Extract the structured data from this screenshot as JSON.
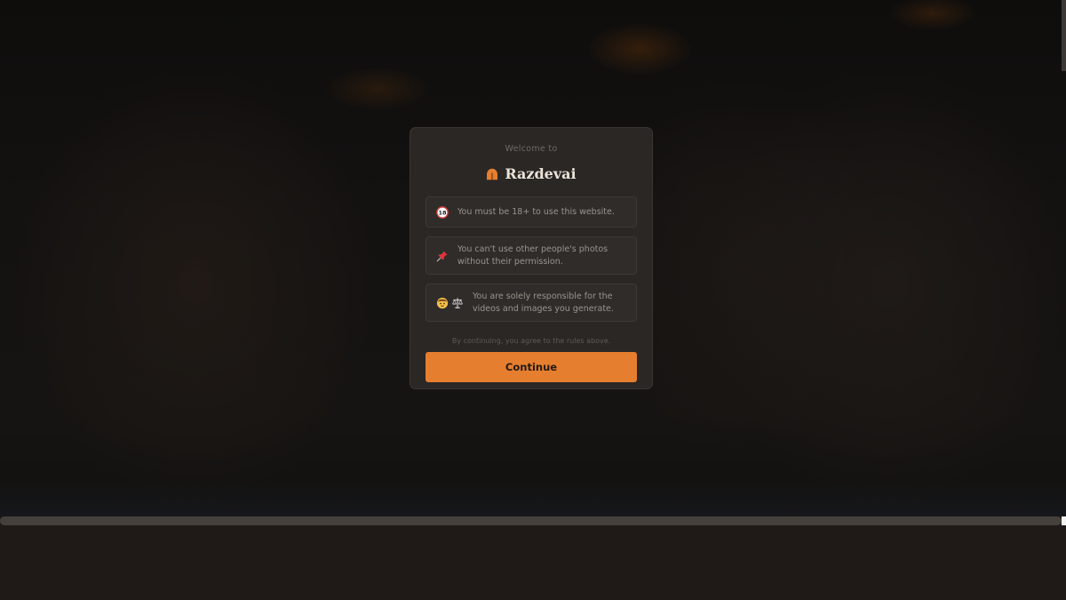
{
  "modal": {
    "welcome_text": "Welcome to",
    "brand_name": "Razdevai",
    "rules": [
      {
        "icons": [
          "18-plus-icon"
        ],
        "text": "You must be 18+ to use this website."
      },
      {
        "icons": [
          "pin-icon"
        ],
        "text": "You can't use other people's photos without their permission."
      },
      {
        "icons": [
          "person-icon",
          "scales-icon"
        ],
        "text": "You are solely responsible for the videos and images you generate."
      }
    ],
    "agree_text": "By continuing, you agree to the rules above.",
    "continue_label": "Continue",
    "colors": {
      "accent": "#e67e2f",
      "modal_bg": "#2a2725",
      "brand_text": "#ebe3d8"
    }
  }
}
